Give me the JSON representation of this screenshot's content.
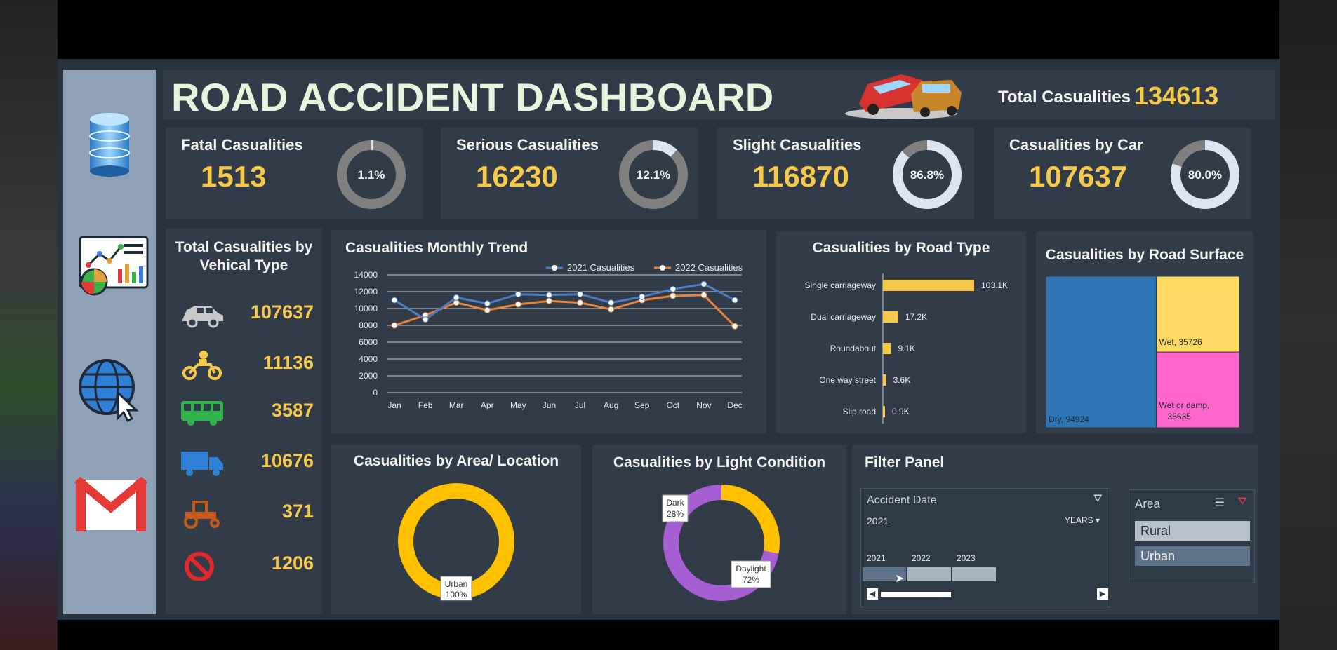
{
  "header": {
    "title": "ROAD ACCIDENT DASHBOARD",
    "total_label": "Total Casualities",
    "total_value": "134613"
  },
  "sidebar": {
    "items": [
      {
        "icon": "database-icon"
      },
      {
        "icon": "report-chart-icon"
      },
      {
        "icon": "globe-cursor-icon"
      },
      {
        "icon": "gmail-icon"
      }
    ]
  },
  "kpis": [
    {
      "label": "Fatal Casualities",
      "value": "1513",
      "pct_label": "1.1%",
      "pct": 0.011
    },
    {
      "label": "Serious Casualities",
      "value": "16230",
      "pct_label": "12.1%",
      "pct": 0.121
    },
    {
      "label": "Slight Casualities",
      "value": "116870",
      "pct_label": "86.8%",
      "pct": 0.868
    },
    {
      "label": "Casualities by Car",
      "value": "107637",
      "pct_label": "80.0%",
      "pct": 0.8
    }
  ],
  "vehicle_panel": {
    "title_line1": "Total Casualities by",
    "title_line2": "Vehical Type",
    "rows": [
      {
        "icon": "car-icon",
        "value": "107637"
      },
      {
        "icon": "motorcycle-icon",
        "value": "11136"
      },
      {
        "icon": "bus-icon",
        "value": "3587"
      },
      {
        "icon": "truck-icon",
        "value": "10676"
      },
      {
        "icon": "tractor-icon",
        "value": "371"
      },
      {
        "icon": "prohibited-icon",
        "value": "1206"
      }
    ]
  },
  "panels": {
    "monthly_trend": "Casualities Monthly Trend",
    "road_type": "Casualities by Road Type",
    "road_surface": "Casualities by Road Surface",
    "area": "Casualities by Area/ Location",
    "light": "Casualities by Light Condition",
    "filter": "Filter Panel"
  },
  "colors": {
    "accent_yellow": "#f7c94a",
    "series_2021": "#4a7cc7",
    "series_2022": "#e8833a",
    "dry": "#2e75b6",
    "wet": "#ffd966",
    "wet_damp": "#ff66cc",
    "daylight": "#a65ed3",
    "dark": "#ffc000"
  },
  "chart_data": [
    {
      "type": "line",
      "title": "Casualities Monthly Trend",
      "categories": [
        "Jan",
        "Feb",
        "Mar",
        "Apr",
        "May",
        "Jun",
        "Jul",
        "Aug",
        "Sep",
        "Oct",
        "Nov",
        "Dec"
      ],
      "series": [
        {
          "name": "2021 Casualities",
          "values": [
            11000,
            8700,
            11300,
            10600,
            11700,
            11600,
            11700,
            10700,
            11400,
            12300,
            12900,
            11000
          ]
        },
        {
          "name": "2022 Casualities",
          "values": [
            8000,
            9200,
            10700,
            9800,
            10500,
            10900,
            10700,
            9900,
            11000,
            11500,
            11600,
            7900
          ]
        }
      ],
      "ylim": [
        0,
        14000
      ],
      "yticks": [
        0,
        2000,
        4000,
        6000,
        8000,
        10000,
        12000,
        14000
      ],
      "grid": true,
      "legend": "top-right"
    },
    {
      "type": "bar",
      "orientation": "horizontal",
      "title": "Casualities by Road Type",
      "categories": [
        "Single carriageway",
        "Dual carriageway",
        "Roundabout",
        "One way street",
        "Slip road"
      ],
      "values": [
        103100,
        17200,
        9100,
        3600,
        900
      ],
      "labels": [
        "103.1K",
        "17.2K",
        "9.1K",
        "3.6K",
        "0.9K"
      ]
    },
    {
      "type": "treemap",
      "title": "Casualities by Road Surface",
      "items": [
        {
          "name": "Dry",
          "value": 94924,
          "label": "Dry, 94924"
        },
        {
          "name": "Wet",
          "value": 35726,
          "label": "Wet, 35726"
        },
        {
          "name": "Wet or damp",
          "value": 35635,
          "label_line1": "Wet or damp,",
          "label_line2": "35635"
        }
      ]
    },
    {
      "type": "pie",
      "title": "Casualities by Area/ Location",
      "slices": [
        {
          "name": "Urban",
          "value": 100,
          "label": "100%"
        }
      ]
    },
    {
      "type": "pie",
      "title": "Casualities by Light Condition",
      "slices": [
        {
          "name": "Dark",
          "value": 28,
          "label": "28%"
        },
        {
          "name": "Daylight",
          "value": 72,
          "label": "72%"
        }
      ]
    }
  ],
  "filter": {
    "date_title": "Accident Date",
    "selected_year": "2021",
    "period_selector": "YEARS",
    "years": [
      "2021",
      "2022",
      "2023"
    ],
    "area_title": "Area",
    "area_options": [
      "Rural",
      "Urban"
    ]
  }
}
